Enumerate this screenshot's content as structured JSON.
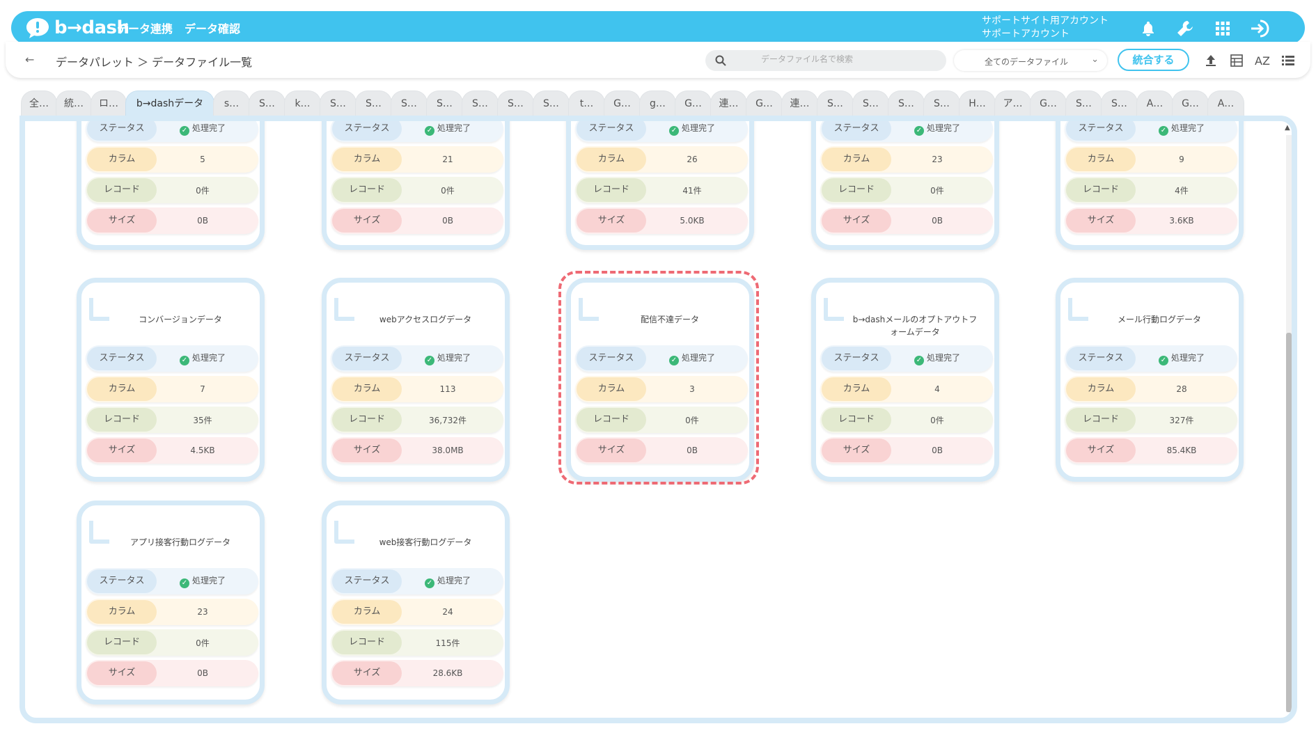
{
  "header": {
    "logo_text": "b→dash",
    "nav": [
      "データ連携",
      "データ確認"
    ],
    "account_line1": "サポートサイト用アカウント",
    "account_line2": "サポートアカウント",
    "icons": [
      "bell-icon",
      "wrench-icon",
      "apps-grid-icon",
      "logout-icon"
    ],
    "brand_color": "#40c3ee"
  },
  "subbar": {
    "back_icon": "←",
    "breadcrumb": "データパレット ＞ データファイル一覧",
    "search_placeholder": "データファイル名で検索",
    "filter_value": "全てのデータファイル",
    "merge_label": "統合する",
    "tool_icons": [
      "upload-icon",
      "table-view-icon",
      "az-sort-icon",
      "list-view-icon"
    ],
    "az_label": "AZ"
  },
  "tabs": [
    "全…",
    "統…",
    "ロ…",
    "b→dashデータ",
    "s…",
    "S…",
    "k…",
    "S…",
    "S…",
    "S…",
    "S…",
    "S…",
    "S…",
    "S…",
    "t…",
    "G…",
    "g…",
    "G…",
    "連…",
    "G…",
    "連…",
    "S…",
    "S…",
    "S…",
    "S…",
    "H…",
    "ア…",
    "G…",
    "S…",
    "S…",
    "A…",
    "G…",
    "A…"
  ],
  "active_tab": 3,
  "labels": {
    "status": "ステータス",
    "column": "カラム",
    "record": "レコード",
    "size": "サイズ"
  },
  "cards_top": [
    {
      "status": "処理完了",
      "columns": "5",
      "records": "0件",
      "size": "0B"
    },
    {
      "status": "処理完了",
      "columns": "21",
      "records": "0件",
      "size": "0B"
    },
    {
      "status": "処理完了",
      "columns": "26",
      "records": "41件",
      "size": "5.0KB"
    },
    {
      "status": "処理完了",
      "columns": "23",
      "records": "0件",
      "size": "0B"
    },
    {
      "status": "処理完了",
      "columns": "9",
      "records": "4件",
      "size": "3.6KB"
    }
  ],
  "cards": [
    {
      "name": "コンバージョンデータ",
      "status": "処理完了",
      "columns": "7",
      "records": "35件",
      "size": "4.5KB"
    },
    {
      "name": "webアクセスログデータ",
      "status": "処理完了",
      "columns": "113",
      "records": "36,732件",
      "size": "38.0MB"
    },
    {
      "name": "配信不達データ",
      "status": "処理完了",
      "columns": "3",
      "records": "0件",
      "size": "0B"
    },
    {
      "name": "b→dashメールのオプトアウトフォームデータ",
      "status": "処理完了",
      "columns": "4",
      "records": "0件",
      "size": "0B"
    },
    {
      "name": "メール行動ログデータ",
      "status": "処理完了",
      "columns": "28",
      "records": "327件",
      "size": "85.4KB"
    },
    {
      "name": "アプリ接客行動ログデータ",
      "status": "処理完了",
      "columns": "23",
      "records": "0件",
      "size": "0B"
    },
    {
      "name": "web接客行動ログデータ",
      "status": "処理完了",
      "columns": "24",
      "records": "115件",
      "size": "28.6KB"
    }
  ],
  "highlighted_card": 2,
  "highlight_color": "#ee6a74"
}
